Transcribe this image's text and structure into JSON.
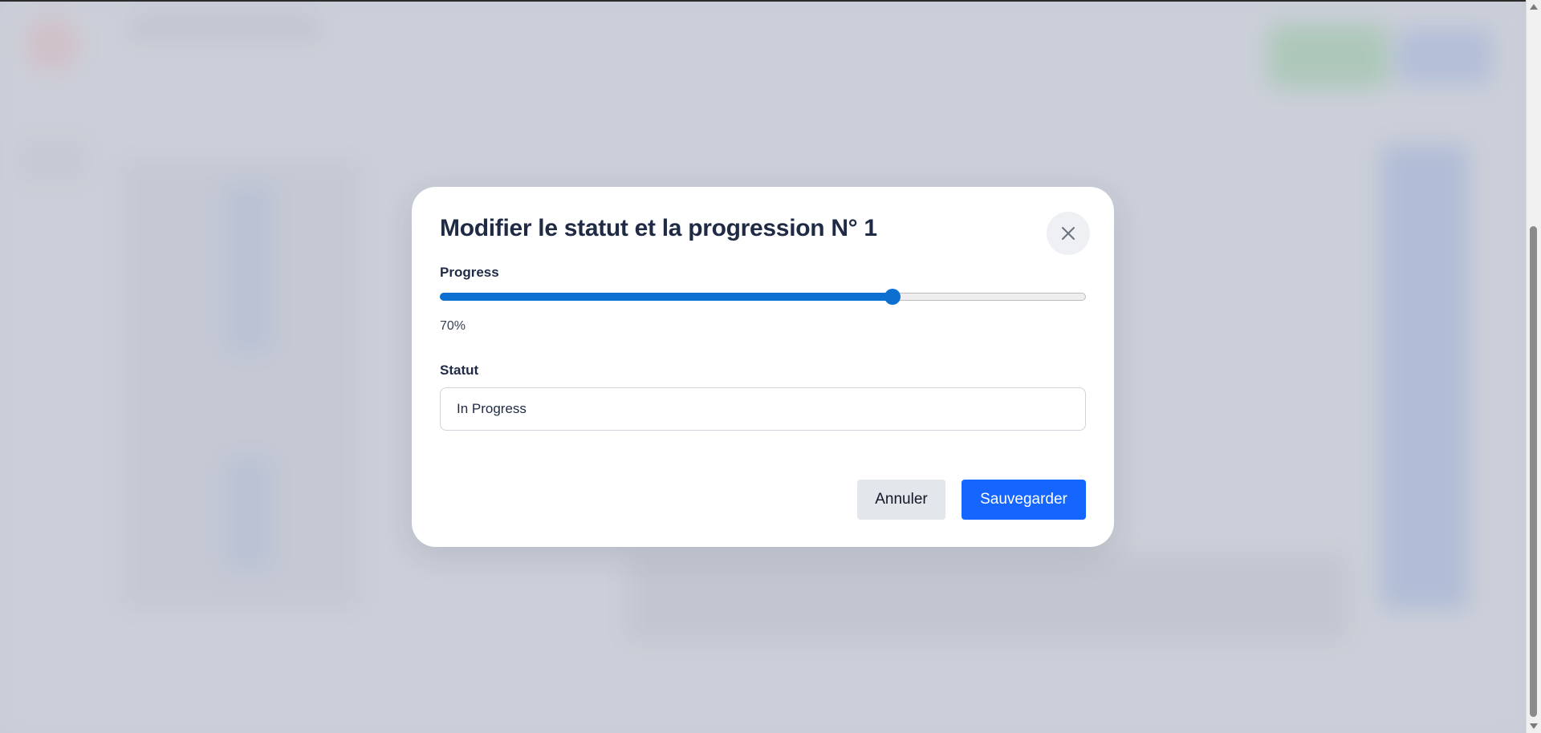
{
  "modal": {
    "title": "Modifier le statut et la progression N° 1",
    "close_icon": "close-icon",
    "progress": {
      "label": "Progress",
      "value": 70,
      "value_text": "70%"
    },
    "status": {
      "label": "Statut",
      "value": "In Progress"
    },
    "buttons": {
      "cancel_label": "Annuler",
      "save_label": "Sauvegarder"
    }
  },
  "colors": {
    "accent": "#0b70d0",
    "primary_button": "#1565ff",
    "cancel_button": "#e3e6eb",
    "title_text": "#1f2a44"
  }
}
